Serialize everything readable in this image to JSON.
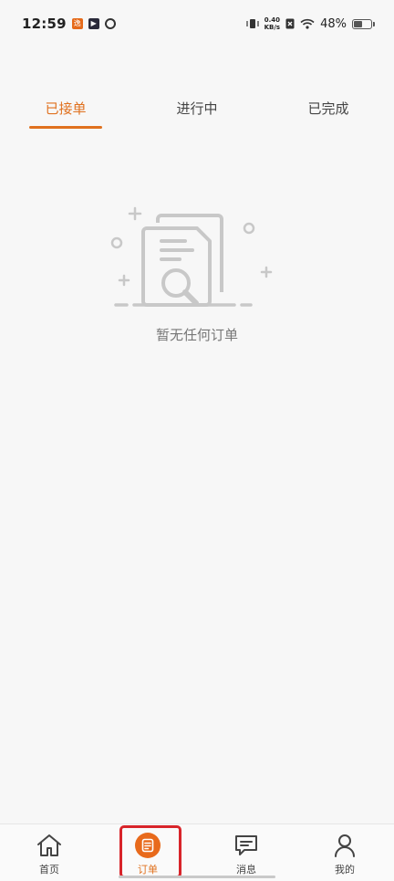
{
  "status_bar": {
    "time": "12:59",
    "app_badge_1": "逸",
    "app_badge_2": "▶",
    "net_speed_value": "0.40",
    "net_speed_unit": "KB/s",
    "sim_icon": "sim-x-icon",
    "battery_percent": "48%",
    "battery_level": 0.48
  },
  "tabs": [
    {
      "label": "已接单",
      "active": true
    },
    {
      "label": "进行中",
      "active": false
    },
    {
      "label": "已完成",
      "active": false
    }
  ],
  "empty_state": {
    "icon": "empty-orders-illustration",
    "message": "暂无任何订单"
  },
  "bottom_nav": [
    {
      "label": "首页",
      "icon": "home-icon",
      "active": false
    },
    {
      "label": "订单",
      "icon": "orders-icon",
      "active": true
    },
    {
      "label": "消息",
      "icon": "message-icon",
      "active": false
    },
    {
      "label": "我的",
      "icon": "profile-icon",
      "active": false
    }
  ],
  "colors": {
    "accent": "#e0711f",
    "highlight": "#d8242a",
    "background": "#f7f7f7"
  }
}
